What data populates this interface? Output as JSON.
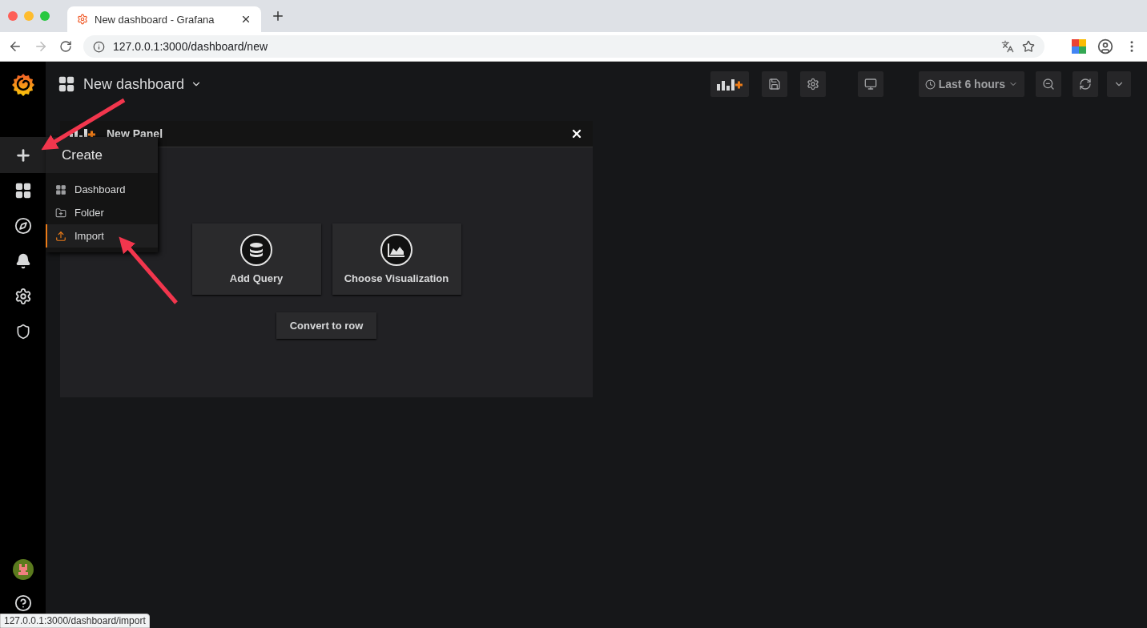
{
  "browser": {
    "tab_title": "New dashboard - Grafana",
    "url": "127.0.0.1:3000/dashboard/new",
    "status_url": "127.0.0.1:3000/dashboard/import"
  },
  "sidebar": {
    "items": [
      {
        "kind": "create",
        "selected": true
      },
      {
        "kind": "dashboards",
        "selected": false
      },
      {
        "kind": "explore",
        "selected": false
      },
      {
        "kind": "alerting",
        "selected": false
      },
      {
        "kind": "configuration",
        "selected": false
      },
      {
        "kind": "admin",
        "selected": false
      }
    ]
  },
  "create_menu": {
    "title": "Create",
    "items": [
      {
        "kind": "dashboard",
        "label": "Dashboard",
        "selected": false
      },
      {
        "kind": "folder",
        "label": "Folder",
        "selected": false
      },
      {
        "kind": "import",
        "label": "Import",
        "selected": true
      }
    ]
  },
  "header": {
    "title": "New dashboard",
    "time_range": "Last 6 hours"
  },
  "toolbar": [
    {
      "kind": "add-panel"
    },
    {
      "kind": "save"
    },
    {
      "kind": "settings"
    },
    {
      "kind": "tv"
    }
  ],
  "panel": {
    "title": "New Panel",
    "actions": [
      {
        "kind": "query",
        "label": "Add Query"
      },
      {
        "kind": "visualization",
        "label": "Choose Visualization"
      }
    ],
    "convert_label": "Convert to row"
  }
}
